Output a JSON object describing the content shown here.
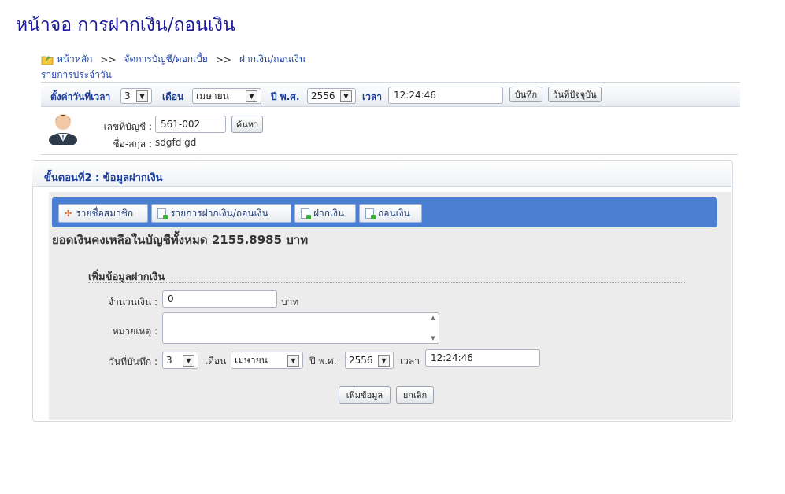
{
  "page_title": "หน้าจอ การฝากเงิน/ถอนเงิน",
  "breadcrumb": {
    "items": [
      "หน้าหลัก",
      "จัดการบัญชี/ดอกเบี้ย",
      "ฝากเงิน/ถอนเงิน"
    ],
    "separator": ">>",
    "sub": "รายการประจำวัน"
  },
  "time_settings": {
    "label": "ตั้งค่าวันที่เวลา",
    "day": "3",
    "month_label": "เดือน",
    "month": "เมษายน",
    "year_label": "ปี พ.ศ.",
    "year": "2556",
    "time_label": "เวลา",
    "time": "12:24:46",
    "save_button": "บันทึก",
    "today_button": "วันที่ปัจจุบัน"
  },
  "member": {
    "account_label": "เลขที่บัญชี :",
    "account_no": "561-002",
    "search_button": "ค้นหา",
    "name_label": "ชื่อ-สกุล :",
    "name": "sdgfd gd"
  },
  "panel": {
    "title": "ขั้นตอนที่2 : ข้อมูลฝากเงิน",
    "tabs": [
      {
        "label": "รายชื่อสมาชิก",
        "icon": "member-list-icon"
      },
      {
        "label": "รายการฝากเงิน/ถอนเงิน",
        "icon": "document-icon"
      },
      {
        "label": "ฝากเงิน",
        "icon": "document-icon"
      },
      {
        "label": "ถอนเงิน",
        "icon": "document-icon"
      }
    ],
    "balance_text": "ยอดเงินคงเหลือในบัญชีทั้งหมด 2155.8985 บาท"
  },
  "deposit_form": {
    "title": "เพิ่มข้อมูลฝากเงิน",
    "amount_label": "จำนวนเงิน :",
    "amount_value": "0",
    "amount_unit": "บาท",
    "note_label": "หมายเหตุ :",
    "note_value": "",
    "date_label": "วันที่บันทึก :",
    "day": "3",
    "month_label": "เดือน",
    "month": "เมษายน",
    "year_label": "ปี พ.ศ.",
    "year": "2556",
    "time_label": "เวลา",
    "time": "12:24:46",
    "add_button": "เพิ่มข้อมูล",
    "cancel_button": "ยกเลิก"
  },
  "colors": {
    "title": "#1a1a9c",
    "link": "#2244aa",
    "tab_bar": "#4a7fd4"
  }
}
